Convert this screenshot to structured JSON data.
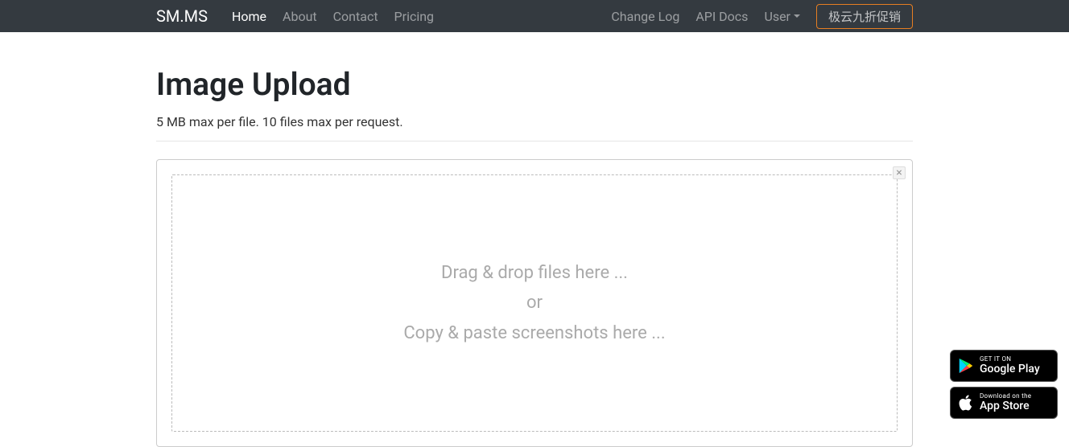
{
  "brand": "SM.MS",
  "nav": {
    "left": [
      {
        "label": "Home",
        "active": true
      },
      {
        "label": "About",
        "active": false
      },
      {
        "label": "Contact",
        "active": false
      },
      {
        "label": "Pricing",
        "active": false
      }
    ],
    "right": [
      {
        "label": "Change Log"
      },
      {
        "label": "API Docs"
      },
      {
        "label": "User",
        "dropdown": true
      }
    ],
    "promo": "极云九折促销"
  },
  "page": {
    "title": "Image Upload",
    "subtitle": "5 MB max per file. 10 files max per request."
  },
  "dropzone": {
    "line1": "Drag & drop files here ...",
    "line2": "or",
    "line3": "Copy & paste screenshots here ..."
  },
  "badges": {
    "google": {
      "small": "GET IT ON",
      "big": "Google Play"
    },
    "apple": {
      "small": "Download on the",
      "big": "App Store"
    }
  }
}
